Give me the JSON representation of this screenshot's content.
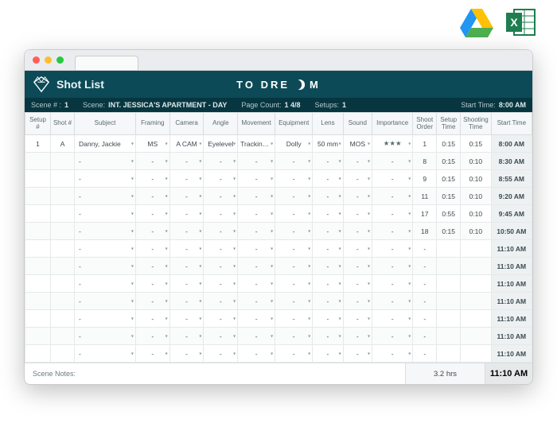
{
  "ext_icons": {
    "drive": "google-drive-icon",
    "excel": "excel-icon"
  },
  "header": {
    "app_title": "Shot List",
    "brand_pre": "TO DRE",
    "brand_post": "M"
  },
  "meta": {
    "scene_no_lbl": "Scene # :",
    "scene_no": "1",
    "scene_lbl": "Scene:",
    "scene": "INT. JESSICA'S APARTMENT - DAY",
    "page_lbl": "Page Count:",
    "page": "1 4/8",
    "setups_lbl": "Setups:",
    "setups": "1",
    "start_lbl": "Start Time:",
    "start": "8:00 AM"
  },
  "cols": [
    "Setup #",
    "Shot #",
    "Subject",
    "Framing",
    "Camera",
    "Angle",
    "Movement",
    "Equipment",
    "Lens",
    "Sound",
    "Importance",
    "Shoot Order",
    "Setup Time",
    "Shooting Time",
    "Start Time"
  ],
  "rows": [
    {
      "setup": "1",
      "shot": "A",
      "subject": "Danny, Jackie",
      "framing": "MS",
      "camera": "A CAM",
      "angle": "Eyelevel",
      "movement": "Tracking Shot",
      "equipment": "Dolly",
      "lens": "50 mm",
      "sound": "MOS",
      "importance": "★★★",
      "order": "1",
      "stime": "0:15",
      "shtime": "0:15",
      "start": "8:00 AM"
    },
    {
      "setup": "",
      "shot": "",
      "subject": "",
      "framing": "",
      "camera": "",
      "angle": "",
      "movement": "",
      "equipment": "",
      "lens": "",
      "sound": "",
      "importance": "",
      "order": "8",
      "stime": "0:15",
      "shtime": "0:10",
      "start": "8:30 AM"
    },
    {
      "setup": "",
      "shot": "",
      "subject": "",
      "framing": "",
      "camera": "",
      "angle": "",
      "movement": "",
      "equipment": "",
      "lens": "",
      "sound": "",
      "importance": "",
      "order": "9",
      "stime": "0:15",
      "shtime": "0:10",
      "start": "8:55 AM"
    },
    {
      "setup": "",
      "shot": "",
      "subject": "",
      "framing": "",
      "camera": "",
      "angle": "",
      "movement": "",
      "equipment": "",
      "lens": "",
      "sound": "",
      "importance": "",
      "order": "11",
      "stime": "0:15",
      "shtime": "0:10",
      "start": "9:20 AM"
    },
    {
      "setup": "",
      "shot": "",
      "subject": "",
      "framing": "",
      "camera": "",
      "angle": "",
      "movement": "",
      "equipment": "",
      "lens": "",
      "sound": "",
      "importance": "",
      "order": "17",
      "stime": "0:55",
      "shtime": "0:10",
      "start": "9:45 AM"
    },
    {
      "setup": "",
      "shot": "",
      "subject": "",
      "framing": "",
      "camera": "",
      "angle": "",
      "movement": "",
      "equipment": "",
      "lens": "",
      "sound": "",
      "importance": "",
      "order": "18",
      "stime": "0:15",
      "shtime": "0:10",
      "start": "10:50 AM"
    },
    {
      "setup": "",
      "shot": "",
      "subject": "",
      "framing": "",
      "camera": "",
      "angle": "",
      "movement": "",
      "equipment": "",
      "lens": "",
      "sound": "",
      "importance": "",
      "order": "",
      "stime": "",
      "shtime": "",
      "start": "11:10 AM"
    },
    {
      "setup": "",
      "shot": "",
      "subject": "",
      "framing": "",
      "camera": "",
      "angle": "",
      "movement": "",
      "equipment": "",
      "lens": "",
      "sound": "",
      "importance": "",
      "order": "",
      "stime": "",
      "shtime": "",
      "start": "11:10 AM"
    },
    {
      "setup": "",
      "shot": "",
      "subject": "",
      "framing": "",
      "camera": "",
      "angle": "",
      "movement": "",
      "equipment": "",
      "lens": "",
      "sound": "",
      "importance": "",
      "order": "",
      "stime": "",
      "shtime": "",
      "start": "11:10 AM"
    },
    {
      "setup": "",
      "shot": "",
      "subject": "",
      "framing": "",
      "camera": "",
      "angle": "",
      "movement": "",
      "equipment": "",
      "lens": "",
      "sound": "",
      "importance": "",
      "order": "",
      "stime": "",
      "shtime": "",
      "start": "11:10 AM"
    },
    {
      "setup": "",
      "shot": "",
      "subject": "",
      "framing": "",
      "camera": "",
      "angle": "",
      "movement": "",
      "equipment": "",
      "lens": "",
      "sound": "",
      "importance": "",
      "order": "",
      "stime": "",
      "shtime": "",
      "start": "11:10 AM"
    },
    {
      "setup": "",
      "shot": "",
      "subject": "",
      "framing": "",
      "camera": "",
      "angle": "",
      "movement": "",
      "equipment": "",
      "lens": "",
      "sound": "",
      "importance": "",
      "order": "",
      "stime": "",
      "shtime": "",
      "start": "11:10 AM"
    },
    {
      "setup": "",
      "shot": "",
      "subject": "",
      "framing": "",
      "camera": "",
      "angle": "",
      "movement": "",
      "equipment": "",
      "lens": "",
      "sound": "",
      "importance": "",
      "order": "",
      "stime": "",
      "shtime": "",
      "start": "11:10 AM"
    }
  ],
  "footer": {
    "notes_lbl": "Scene Notes:",
    "total": "3.2 hrs",
    "end": "11:10 AM"
  }
}
